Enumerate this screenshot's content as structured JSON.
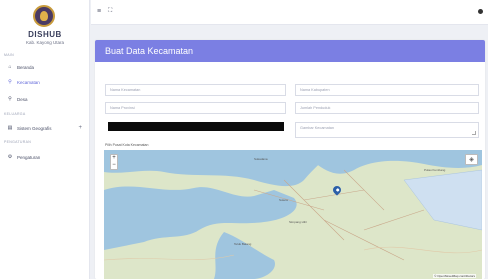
{
  "sidebar": {
    "brand": "DISHUB",
    "brand_sub": "Kab. Kayong Utara",
    "sections": [
      "MAIN",
      "KELUARGA",
      "PENGATURAN"
    ],
    "items": [
      {
        "label": "Beranda",
        "icon": "home-icon"
      },
      {
        "label": "Kecamatan",
        "icon": "map-pin-icon"
      },
      {
        "label": "Desa",
        "icon": "map-pin-icon"
      },
      {
        "label": "Sistem Geografis",
        "icon": "layers-icon"
      },
      {
        "label": "Pengaturan",
        "icon": "gear-icon"
      }
    ]
  },
  "topbar": {
    "menu_glyph": "≡",
    "expand_glyph": "⛶"
  },
  "card": {
    "title": "Buat Data Kecamatan"
  },
  "form": {
    "nama_kecamatan": "Nama Kecamatan",
    "nama_kabupaten": "Nama Kabupaten",
    "nama_provinsi": "Nama Provinsi",
    "jumlah_penduduk": "Jumlah Penduduk",
    "gambar_kecamatan": "Gambar Kecamatan"
  },
  "map": {
    "label": "Pilih Pusat Kota Kecamatan",
    "zoom_in": "+",
    "zoom_out": "−",
    "attribution": "© OpenStreetMap contributors",
    "places": [
      "Sukadana",
      "Pulau Kumbang",
      "Sutera",
      "Simpang Hilir",
      "Teluk Batang"
    ]
  },
  "colors": {
    "accent": "#7b7fe3",
    "active_nav": "#5f66d9",
    "water": "#9fc5df",
    "land": "#dde6c9"
  }
}
